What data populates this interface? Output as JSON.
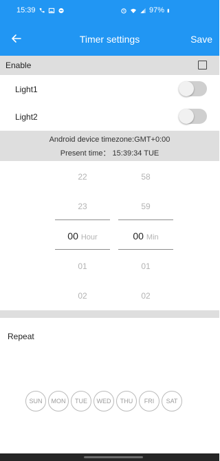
{
  "status_bar": {
    "time": "15:39",
    "battery": "97%",
    "icons_left": [
      "phone-icon",
      "image-icon",
      "chat-icon"
    ],
    "icons_right": [
      "alarm-icon",
      "wifi-icon",
      "signal-icon",
      "battery-icon"
    ]
  },
  "app_bar": {
    "title": "Timer settings",
    "save_label": "Save",
    "back_icon": "arrow-left-icon"
  },
  "enable": {
    "label": "Enable",
    "checked": false
  },
  "lights": [
    {
      "label": "Light1",
      "on": false
    },
    {
      "label": "Light2",
      "on": false
    }
  ],
  "info": {
    "timezone": "Android device timezone:GMT+0:00",
    "present_time": "Present time： 15:39:34 TUE"
  },
  "hour_picker": {
    "values": [
      "22",
      "23",
      "00",
      "01",
      "02"
    ],
    "selected": "00",
    "unit": "Hour"
  },
  "minute_picker": {
    "values": [
      "58",
      "59",
      "00",
      "01",
      "02"
    ],
    "selected": "00",
    "unit": "Min"
  },
  "repeat": {
    "label": "Repeat",
    "days": [
      "SUN",
      "MON",
      "TUE",
      "WED",
      "THU",
      "FRI",
      "SAT"
    ]
  },
  "colors": {
    "primary": "#2196f3",
    "section_bg": "#dedede"
  }
}
